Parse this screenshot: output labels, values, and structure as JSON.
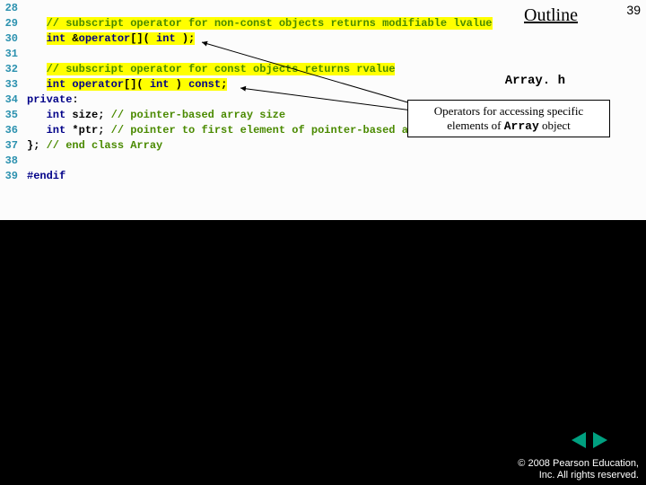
{
  "header": {
    "outline": "Outline",
    "page": "39",
    "filename": "Array. h"
  },
  "callout": {
    "pre": "Operators for accessing specific elements of ",
    "mono": "Array",
    "post": " object"
  },
  "code": {
    "lines": [
      {
        "n": "28",
        "parts": [],
        "hl": false,
        "indent": "   "
      },
      {
        "n": "29",
        "parts": [
          {
            "t": "// subscript operator for non-const objects returns modifiable lvalue",
            "c": "cm"
          }
        ],
        "hl": true,
        "indent": "   "
      },
      {
        "n": "30",
        "parts": [
          {
            "t": "int ",
            "c": "kw"
          },
          {
            "t": "&",
            "c": "plain"
          },
          {
            "t": "operator",
            "c": "kw"
          },
          {
            "t": "[]( ",
            "c": "plain"
          },
          {
            "t": "int",
            "c": "kw"
          },
          {
            "t": " );",
            "c": "plain"
          }
        ],
        "hl": true,
        "indent": "   "
      },
      {
        "n": "31",
        "parts": [],
        "hl": false,
        "indent": "   "
      },
      {
        "n": "32",
        "parts": [
          {
            "t": "// subscript operator for const objects returns rvalue",
            "c": "cm"
          }
        ],
        "hl": true,
        "indent": "   "
      },
      {
        "n": "33",
        "parts": [
          {
            "t": "int operator",
            "c": "kw"
          },
          {
            "t": "[]( ",
            "c": "plain"
          },
          {
            "t": "int",
            "c": "kw"
          },
          {
            "t": " ) ",
            "c": "plain"
          },
          {
            "t": "const",
            "c": "kw"
          },
          {
            "t": ";",
            "c": "plain"
          }
        ],
        "hl": true,
        "indent": "   "
      },
      {
        "n": "34",
        "parts": [
          {
            "t": "private",
            "c": "kw"
          },
          {
            "t": ":",
            "c": "plain"
          }
        ],
        "hl": false,
        "indent": ""
      },
      {
        "n": "35",
        "parts": [
          {
            "t": "int",
            "c": "kw"
          },
          {
            "t": " size; ",
            "c": "plain"
          },
          {
            "t": "// pointer-based array size",
            "c": "cm"
          }
        ],
        "hl": false,
        "indent": "   "
      },
      {
        "n": "36",
        "parts": [
          {
            "t": "int",
            "c": "kw"
          },
          {
            "t": " *ptr; ",
            "c": "plain"
          },
          {
            "t": "// pointer to first element of pointer-based array",
            "c": "cm"
          }
        ],
        "hl": false,
        "indent": "   "
      },
      {
        "n": "37",
        "parts": [
          {
            "t": "}; ",
            "c": "plain"
          },
          {
            "t": "// end class Array",
            "c": "cm"
          }
        ],
        "hl": false,
        "indent": ""
      },
      {
        "n": "38",
        "parts": [],
        "hl": false,
        "indent": ""
      },
      {
        "n": "39",
        "parts": [
          {
            "t": "#endif",
            "c": "kw"
          }
        ],
        "hl": false,
        "indent": ""
      }
    ]
  },
  "footer": {
    "copyright1": "© 2008 Pearson Education,",
    "copyright2": "Inc.  All rights reserved."
  }
}
